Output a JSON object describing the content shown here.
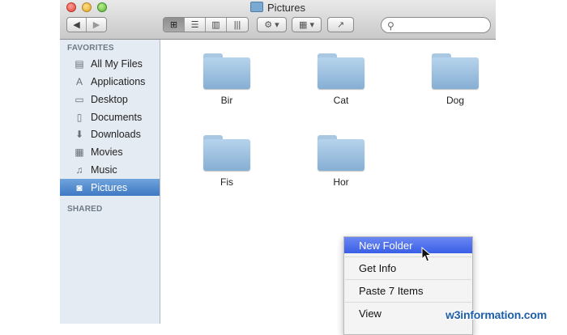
{
  "window": {
    "title": "Pictures"
  },
  "toolbar": {
    "nav": {
      "back_icon": "chevron-left",
      "forward_icon": "chevron-right"
    },
    "view_modes": [
      {
        "icon": "icon-view",
        "glyph": "⊞",
        "active": true
      },
      {
        "icon": "list-view",
        "glyph": "☰",
        "active": false
      },
      {
        "icon": "column-view",
        "glyph": "▥",
        "active": false
      },
      {
        "icon": "coverflow-view",
        "glyph": "|||",
        "active": false
      }
    ],
    "action_glyph": "⚙ ▾",
    "arrange_glyph": "▦ ▾",
    "share_glyph": "↗",
    "search": {
      "placeholder": "",
      "icon": "search-icon"
    }
  },
  "sidebar": {
    "favorites_heading": "FAVORITES",
    "shared_heading": "SHARED",
    "items": [
      {
        "label": "All My Files",
        "icon": "all-files-icon",
        "glyph": "▤",
        "selected": false
      },
      {
        "label": "Applications",
        "icon": "applications-icon",
        "glyph": "A",
        "selected": false
      },
      {
        "label": "Desktop",
        "icon": "desktop-icon",
        "glyph": "▭",
        "selected": false
      },
      {
        "label": "Documents",
        "icon": "documents-icon",
        "glyph": "▯",
        "selected": false
      },
      {
        "label": "Downloads",
        "icon": "downloads-icon",
        "glyph": "⬇",
        "selected": false
      },
      {
        "label": "Movies",
        "icon": "movies-icon",
        "glyph": "▦",
        "selected": false
      },
      {
        "label": "Music",
        "icon": "music-icon",
        "glyph": "♫",
        "selected": false
      },
      {
        "label": "Pictures",
        "icon": "pictures-icon",
        "glyph": "◙",
        "selected": true
      }
    ]
  },
  "content": {
    "folders": [
      {
        "label": "Bir"
      },
      {
        "label": "Cat"
      },
      {
        "label": "Dog"
      },
      {
        "label": "Fis"
      },
      {
        "label": "Hor"
      }
    ]
  },
  "context_menu": {
    "items": [
      {
        "label": "New Folder",
        "highlighted": true
      },
      {
        "label": "Get Info",
        "highlighted": false
      },
      {
        "label": "Paste 7 Items",
        "highlighted": false
      },
      {
        "label": "View",
        "highlighted": false
      }
    ]
  },
  "watermark": "w3information.com",
  "colors": {
    "selection": "#3f79c4",
    "menu_highlight": "#3a5fe6",
    "folder": "#86afd4",
    "sidebar": "#e5ebf2"
  }
}
